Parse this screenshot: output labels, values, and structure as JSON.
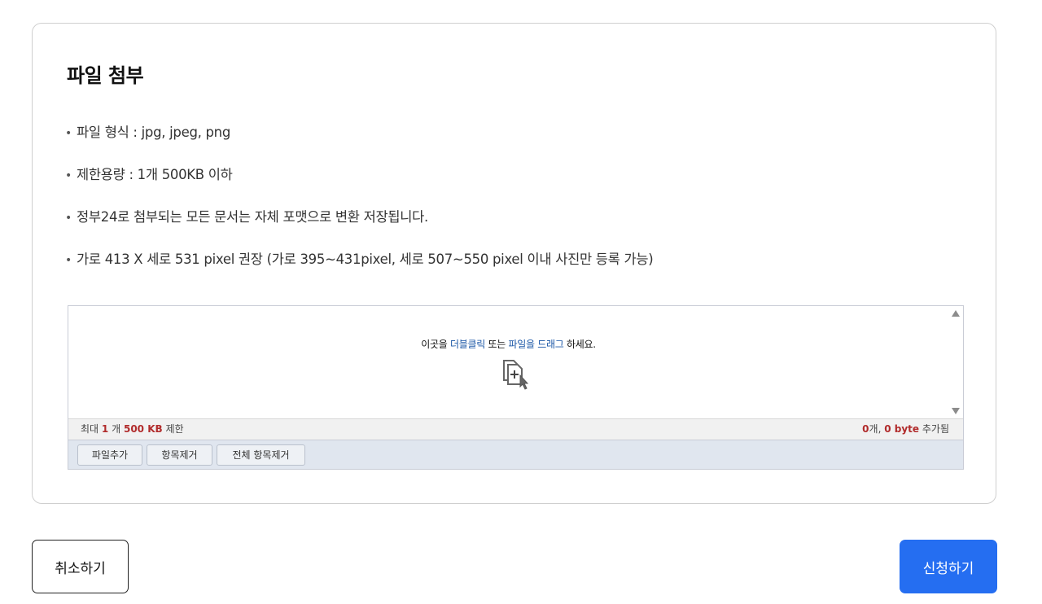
{
  "section": {
    "title": "파일 첨부",
    "notes": [
      "파일 형식 : jpg, jpeg, png",
      "제한용량 : 1개 500KB 이하",
      "정부24로 첨부되는 모든 문서는 자체 포맷으로 변환 저장됩니다.",
      "가로 413 X 세로 531 pixel 권장 (가로 395~431pixel, 세로 507~550 pixel 이내 사진만 등록 가능)"
    ]
  },
  "uploader": {
    "drop_text_1": "이곳을",
    "drop_text_hl1": "더블클릭",
    "drop_text_2": "또는",
    "drop_text_hl2": "파일을 드래그",
    "drop_text_3": "하세요.",
    "drop_icon": "file-add-cursor-icon",
    "limit_prefix": "최대",
    "limit_count": "1",
    "limit_count_unit": "개",
    "limit_size": "500 KB",
    "limit_suffix": "제한",
    "added_count": "0",
    "added_count_unit": "개,",
    "added_size": "0 byte",
    "added_suffix": "추가됨",
    "buttons": {
      "add_file": "파일추가",
      "remove_item": "항목제거",
      "remove_all": "전체 항목제거"
    }
  },
  "footer": {
    "cancel_label": "취소하기",
    "submit_label": "신청하기"
  },
  "colors": {
    "accent": "#256ef1",
    "highlight_text": "#1a56a6",
    "count_red": "#b12b2b"
  }
}
